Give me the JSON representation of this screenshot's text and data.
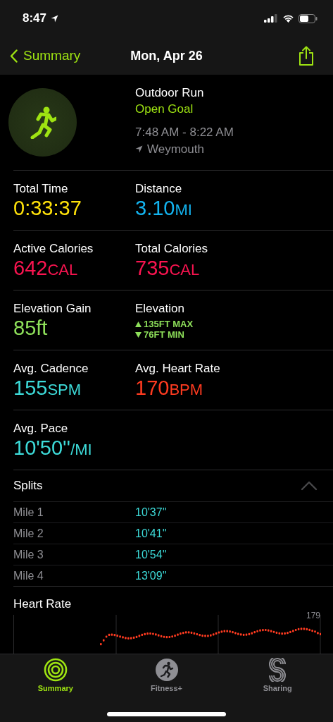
{
  "status_bar": {
    "time": "8:47"
  },
  "nav": {
    "back": "Summary",
    "title": "Mon, Apr 26"
  },
  "workout": {
    "type": "Outdoor Run",
    "goal": "Open Goal",
    "time_range": "7:48 AM - 8:22 AM",
    "location": "Weymouth"
  },
  "metric_rows": [
    [
      {
        "kind": "value",
        "label": "Total Time",
        "value": "0:33:37",
        "color": "#ffe20a"
      },
      {
        "kind": "value",
        "label": "Distance",
        "value": "3.10",
        "unit": "MI",
        "color": "#13b4f0"
      }
    ],
    [
      {
        "kind": "value",
        "label": "Active Calories",
        "value": "642",
        "unit": "CAL",
        "color": "#fa1450"
      },
      {
        "kind": "value",
        "label": "Total Calories",
        "value": "735",
        "unit": "CAL",
        "color": "#fa1450"
      }
    ],
    [
      {
        "kind": "value",
        "label": "Elevation Gain",
        "value": "85ft",
        "color": "#8ee05a"
      },
      {
        "kind": "range",
        "label": "Elevation",
        "max": "135FT MAX",
        "min": "76FT MIN",
        "color": "#8ee05a"
      }
    ],
    [
      {
        "kind": "value",
        "label": "Avg. Cadence",
        "value": "155",
        "unit": "SPM",
        "color": "#3ddbd9"
      },
      {
        "kind": "value",
        "label": "Avg. Heart Rate",
        "value": "170",
        "unit": "BPM",
        "color": "#ff3b20"
      }
    ],
    [
      {
        "kind": "value",
        "label": "Avg. Pace",
        "value": "10'50''",
        "unit": "/MI",
        "color": "#3ddbd9"
      }
    ]
  ],
  "splits": {
    "title": "Splits",
    "expanded": true,
    "rows": [
      {
        "label": "Mile 1",
        "pace": "10'37''"
      },
      {
        "label": "Mile 2",
        "pace": "10'41''"
      },
      {
        "label": "Mile 3",
        "pace": "10'54''"
      },
      {
        "label": "Mile 4",
        "pace": "13'09''"
      }
    ]
  },
  "heart_rate": {
    "title": "Heart Rate",
    "max_label": "179"
  },
  "tabs": [
    {
      "kind": "rings",
      "label": "Summary",
      "selected": true
    },
    {
      "kind": "runner",
      "label": "Fitness+",
      "selected": false
    },
    {
      "kind": "sharing",
      "label": "Sharing",
      "selected": false
    }
  ]
}
